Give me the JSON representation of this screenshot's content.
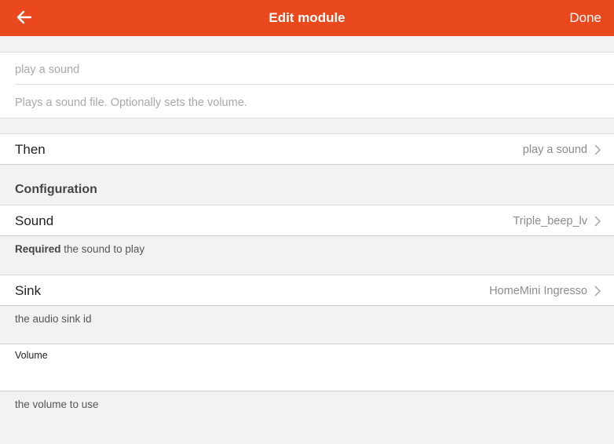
{
  "header": {
    "title": "Edit module",
    "done_label": "Done",
    "back_icon": "arrow-left-icon",
    "background_color": "#e9491d"
  },
  "module": {
    "name": "play a sound",
    "description": "Plays a sound file. Optionally sets the volume."
  },
  "then_row": {
    "label": "Then",
    "value": "play a sound"
  },
  "configuration": {
    "header": "Configuration",
    "sound": {
      "label": "Sound",
      "value": "Triple_beep_lv",
      "required_label": "Required",
      "help": "the sound to play"
    },
    "sink": {
      "label": "Sink",
      "value": "HomeMini Ingresso",
      "help": "the audio sink id"
    },
    "volume": {
      "label": "Volume",
      "value": "",
      "help": "the volume to use"
    }
  }
}
